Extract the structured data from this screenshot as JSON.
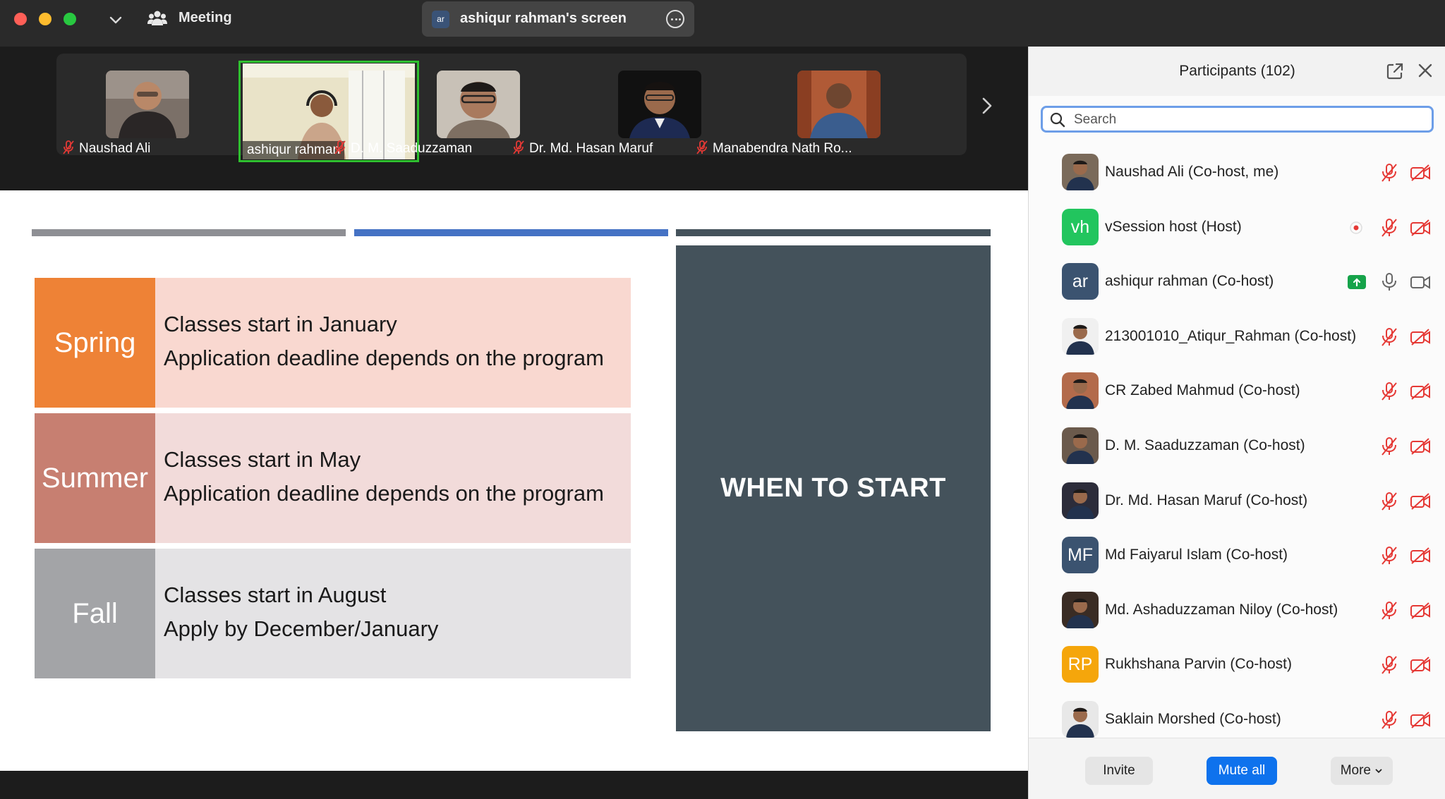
{
  "window": {
    "meeting_label": "Meeting",
    "share_avatar_initials": "ar",
    "share_title": "ashiqur rahman's screen"
  },
  "video_strip": {
    "tiles": [
      {
        "name": "Naushad Ali",
        "muted": true,
        "active": false
      },
      {
        "name": "ashiqur rahman",
        "muted": false,
        "active": true
      },
      {
        "name": "D. M. Saaduzzaman",
        "muted": true,
        "active": false
      },
      {
        "name": "Dr. Md. Hasan Maruf",
        "muted": true,
        "active": false
      },
      {
        "name": "Manabendra Nath Ro...",
        "muted": true,
        "active": false
      }
    ]
  },
  "slide": {
    "seasons": [
      {
        "label": "Spring",
        "line1": "Classes start in January",
        "line2": "Application deadline depends on the program"
      },
      {
        "label": "Summer",
        "line1": "Classes start in May",
        "line2": "Application deadline depends on the program"
      },
      {
        "label": "Fall",
        "line1": "Classes start in August",
        "line2": "Apply by December/January"
      }
    ],
    "heading": "WHEN TO START",
    "colors": {
      "spring": "#ee8236",
      "summer": "#c77f71",
      "fall": "#a3a4a7",
      "dark_box": "#44525b",
      "accent_bar": "#4572c4"
    }
  },
  "participants": {
    "title": "Participants (102)",
    "search_placeholder": "Search",
    "list": [
      {
        "name": "Naushad Ali (Co-host, me)",
        "avatar": "photo",
        "initials": "",
        "color": "#7a6a5a",
        "mic": "muted",
        "video": "off"
      },
      {
        "name": "vSession host (Host)",
        "avatar": "initials",
        "initials": "vh",
        "color": "#22c55e",
        "mic": "muted",
        "video": "off",
        "recording": true
      },
      {
        "name": "ashiqur rahman (Co-host)",
        "avatar": "initials",
        "initials": "ar",
        "color": "#3b5370",
        "mic": "on",
        "video": "on",
        "sharing": true
      },
      {
        "name": "213001010_Atiqur_Rahman (Co-host)",
        "avatar": "photo",
        "initials": "",
        "color": "#f0f0f0",
        "mic": "muted",
        "video": "off"
      },
      {
        "name": "CR Zabed Mahmud (Co-host)",
        "avatar": "photo",
        "initials": "",
        "color": "#b36b4b",
        "mic": "muted",
        "video": "off"
      },
      {
        "name": "D. M. Saaduzzaman (Co-host)",
        "avatar": "photo",
        "initials": "",
        "color": "#6b5a4c",
        "mic": "muted",
        "video": "off"
      },
      {
        "name": "Dr. Md. Hasan Maruf (Co-host)",
        "avatar": "photo",
        "initials": "",
        "color": "#2c2c3a",
        "mic": "muted",
        "video": "off"
      },
      {
        "name": "Md Faiyarul Islam (Co-host)",
        "avatar": "initials",
        "initials": "MF",
        "color": "#3b5370",
        "mic": "muted",
        "video": "off"
      },
      {
        "name": "Md. Ashaduzzaman Niloy (Co-host)",
        "avatar": "photo",
        "initials": "",
        "color": "#3a2c24",
        "mic": "muted",
        "video": "off"
      },
      {
        "name": "Rukhshana Parvin (Co-host)",
        "avatar": "initials",
        "initials": "RP",
        "color": "#f5a60b",
        "mic": "muted",
        "video": "off"
      },
      {
        "name": "Saklain Morshed (Co-host)",
        "avatar": "photo",
        "initials": "",
        "color": "#e8e8e8",
        "mic": "muted",
        "video": "off"
      }
    ],
    "footer": {
      "invite": "Invite",
      "mute_all": "Mute all",
      "more": "More"
    }
  }
}
